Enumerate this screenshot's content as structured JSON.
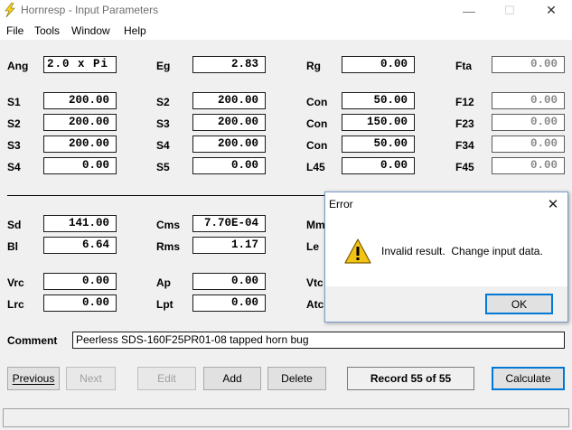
{
  "window": {
    "title": "Hornresp - Input Parameters",
    "minimize_glyph": "—",
    "maximize_glyph": "☐",
    "close_glyph": "✕"
  },
  "menu": [
    "File",
    "Tools",
    "Window",
    "Help"
  ],
  "params_row1": [
    {
      "label": "Ang",
      "value": "2.0 x Pi"
    },
    {
      "label": "Eg",
      "value": "2.83"
    },
    {
      "label": "Rg",
      "value": "0.00"
    },
    {
      "label": "Fta",
      "value": "0.00"
    }
  ],
  "params_horn": [
    [
      {
        "label": "S1",
        "value": "200.00"
      },
      {
        "label": "S2",
        "value": "200.00"
      },
      {
        "label": "Con",
        "value": "50.00"
      },
      {
        "label": "F12",
        "value": "0.00"
      }
    ],
    [
      {
        "label": "S2",
        "value": "200.00"
      },
      {
        "label": "S3",
        "value": "200.00"
      },
      {
        "label": "Con",
        "value": "150.00"
      },
      {
        "label": "F23",
        "value": "0.00"
      }
    ],
    [
      {
        "label": "S3",
        "value": "200.00"
      },
      {
        "label": "S4",
        "value": "200.00"
      },
      {
        "label": "Con",
        "value": "50.00"
      },
      {
        "label": "F34",
        "value": "0.00"
      }
    ],
    [
      {
        "label": "S4",
        "value": "0.00"
      },
      {
        "label": "S5",
        "value": "0.00"
      },
      {
        "label": "L45",
        "value": "0.00"
      },
      {
        "label": "F45",
        "value": "0.00"
      }
    ]
  ],
  "params_driver": [
    [
      {
        "label": "Sd",
        "value": "141.00"
      },
      {
        "label": "Cms",
        "value": "7.70E-04"
      },
      {
        "label": "Mmd"
      }
    ],
    [
      {
        "label": "Bl",
        "value": "6.64"
      },
      {
        "label": "Rms",
        "value": "1.17"
      },
      {
        "label": "Le"
      }
    ]
  ],
  "params_chamber": [
    [
      {
        "label": "Vrc",
        "value": "0.00"
      },
      {
        "label": "Ap",
        "value": "0.00"
      },
      {
        "label": "Vtc"
      }
    ],
    [
      {
        "label": "Lrc",
        "value": "0.00"
      },
      {
        "label": "Lpt",
        "value": "0.00"
      },
      {
        "label": "Atc"
      }
    ]
  ],
  "comment": {
    "label": "Comment",
    "value": "Peerless SDS-160F25PR01-08 tapped horn bug"
  },
  "buttons": {
    "previous": "Previous",
    "next": "Next",
    "edit": "Edit",
    "add": "Add",
    "delete": "Delete",
    "calculate": "Calculate"
  },
  "record": "Record 55 of 55",
  "dialog": {
    "title": "Error",
    "message": "Invalid result.  Change input data.",
    "ok": "OK",
    "icon": "warning-icon"
  },
  "colors": {
    "accent": "#0078d7",
    "warning": "#f4c414",
    "app_icon": "#f7d51d"
  }
}
